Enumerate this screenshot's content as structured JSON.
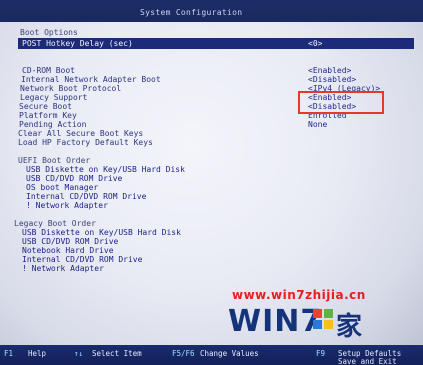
{
  "window": {
    "title": "System Configuration"
  },
  "selected": {
    "label": "POST Hotkey Delay (sec)",
    "value": "<0>"
  },
  "section_header": "Boot Options",
  "settings": [
    {
      "label": "CD-ROM Boot",
      "value": "<Enabled>"
    },
    {
      "label": "Internal Network Adapter Boot",
      "value": "<Disabled>"
    },
    {
      "label": "Network Boot Protocol",
      "value": "<IPv4 (Legacy)>"
    },
    {
      "label": "Legacy Support",
      "value": "<Enabled>"
    },
    {
      "label": "Secure Boot",
      "value": "<Disabled>"
    },
    {
      "label": "Platform Key",
      "value": "Enrolled"
    },
    {
      "label": "Pending Action",
      "value": "None"
    },
    {
      "label": "Clear All Secure Boot Keys",
      "value": ""
    },
    {
      "label": "Load HP Factory Default Keys",
      "value": ""
    }
  ],
  "uefi_boot_order": {
    "title": "UEFI Boot Order",
    "items": [
      "USB Diskette on Key/USB Hard Disk",
      "USB CD/DVD ROM Drive",
      "OS boot Manager",
      "Internal CD/DVD ROM Drive",
      "! Network Adapter"
    ]
  },
  "legacy_boot_order": {
    "title": "Legacy Boot Order",
    "items": [
      "USB Diskette on Key/USB Hard Disk",
      "USB CD/DVD ROM Drive",
      "Notebook Hard Drive",
      "Internal CD/DVD ROM Drive",
      "! Network Adapter"
    ]
  },
  "footer": {
    "f1_key": "F1",
    "f1_label": "Help",
    "nav_key": "↑↓",
    "nav_label": "Select Item",
    "f5f6_key": "F5/F6",
    "f5f6_label": "Change Values",
    "f9_key": "F9",
    "f9_label": "Setup Defaults",
    "f10_label": "Save and Exit"
  },
  "watermark": {
    "url": "www.win7zhijia.cn",
    "logo_text": "WIN7",
    "logo_suffix": "家"
  },
  "colors": {
    "highlight": "#e53a2a",
    "bar": "#1c2a78",
    "text": "#2a3580"
  }
}
